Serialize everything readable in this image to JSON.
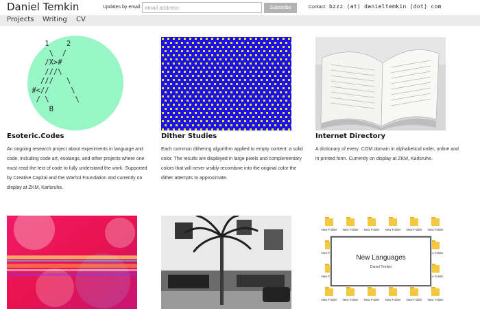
{
  "header": {
    "site_title": "Daniel Temkin",
    "subscribe_label": "Updates by email:",
    "email_placeholder": "email address",
    "subscribe_button": "Subscribe",
    "contact_label": "Contact:",
    "contact_value": "bzzz (at) danieltemkin (dot) com"
  },
  "nav": {
    "items": [
      {
        "label": "Projects"
      },
      {
        "label": "Writing"
      },
      {
        "label": "CV"
      }
    ]
  },
  "projects": [
    {
      "title": "Esoteric.Codes",
      "description": "An ongoing research project about experiments in language and code, including code art, esolangs, and other projects where one must read the text of code to fully understand the work. Supported by Creative Capital and the Warhol Foundation and currently on display at ZKM, Karlsruhe.",
      "thumb_text": "    1    2\n     \\  /\n    /X>#\n    ///\\\n   ///   \\\n #<//     \\\n  / \\      \\\n     B"
    },
    {
      "title": "Dither Studies",
      "description": "Each common dithering algorithm applied to empty content: a solid color. The results are displayed in large pixels and complementary colors that will never visibly recombine into the original color the dither attempts to approximate."
    },
    {
      "title": "Internet Directory",
      "description": "A dictionary of every .COM domain in alphabetical order, online and in printed form. Currently on display at ZKM, Karlsruhe."
    },
    {
      "title": ""
    },
    {
      "title": ""
    },
    {
      "title": "",
      "thumb_title": "New Languages",
      "thumb_subtitle": "Daniel Temkin",
      "folder_label": "New Folder"
    }
  ],
  "colors": {
    "nav_bg": "#ececec",
    "dither_bg": "#1a0ff0",
    "dither_fg": "#e8e026",
    "eso_circle": "#98f5c6",
    "button_bg": "#b3b3b3"
  }
}
